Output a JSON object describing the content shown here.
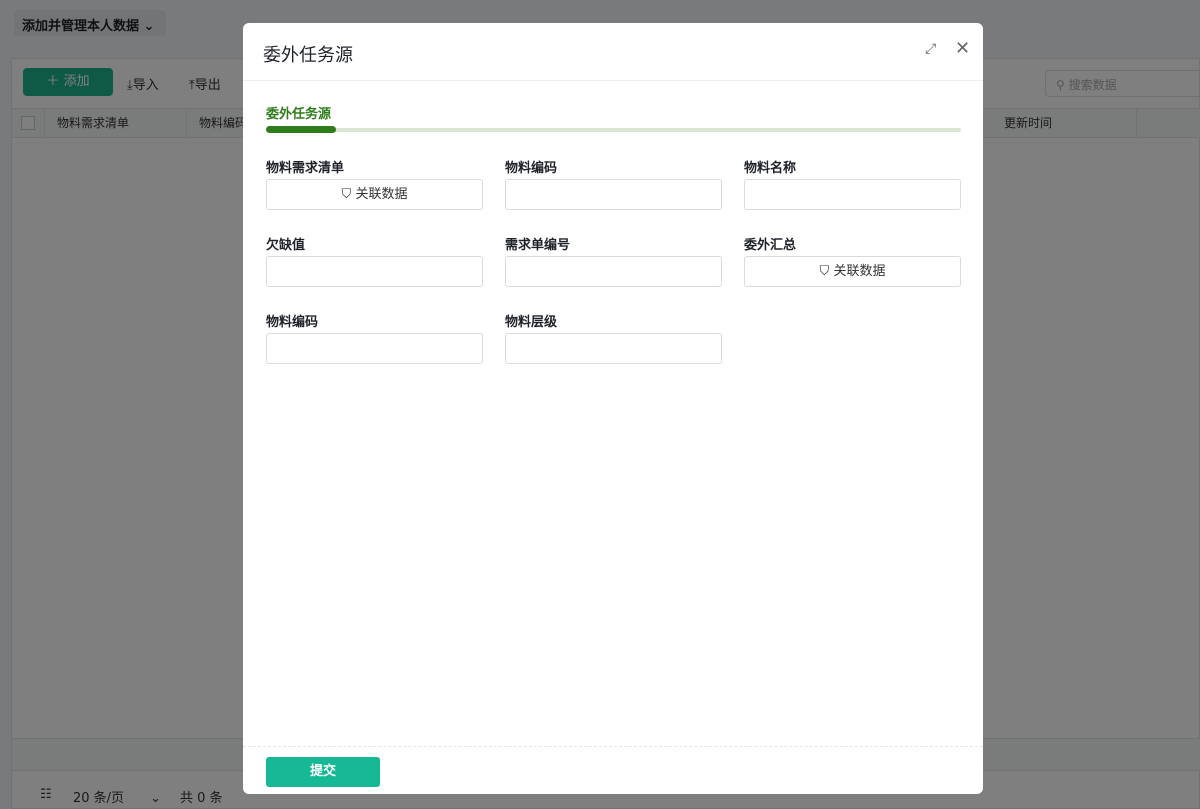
{
  "page": {
    "view_dropdown": "添加并管理本人数据",
    "add_label": "添加",
    "import_label": "导入",
    "export_label": "导出",
    "search_placeholder": "搜索数据",
    "columns": [
      "物料需求清单",
      "物料编码",
      "更新时间"
    ],
    "pager": {
      "size": "20 条/页",
      "total": "共 0 条"
    }
  },
  "modal": {
    "title": "委外任务源",
    "tab": "委外任务源",
    "progress": 0.1,
    "fields": [
      {
        "label": "物料需求清单",
        "type": "link",
        "button": "关联数据"
      },
      {
        "label": "物料编码",
        "type": "text",
        "value": ""
      },
      {
        "label": "物料名称",
        "type": "text",
        "value": ""
      },
      {
        "label": "欠缺值",
        "type": "text",
        "value": ""
      },
      {
        "label": "需求单编号",
        "type": "text",
        "value": ""
      },
      {
        "label": "委外汇总",
        "type": "link",
        "button": "关联数据"
      },
      {
        "label": "物料编码",
        "type": "text",
        "value": ""
      },
      {
        "label": "物料层级",
        "type": "text",
        "value": ""
      }
    ],
    "submit": "提交"
  },
  "colors": {
    "accent": "#16b896",
    "tab": "#2e7d1a"
  }
}
